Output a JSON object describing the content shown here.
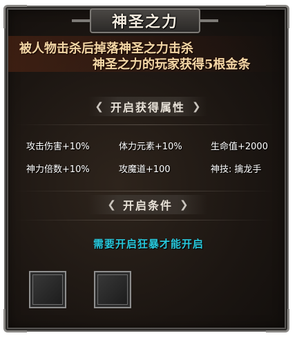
{
  "title": "神圣之力",
  "banner": {
    "line1": "被人物击杀后掉落神圣之力击杀",
    "line2": "神圣之力的玩家获得5根金条"
  },
  "attributes_section": {
    "left_arrow": "❮",
    "label": "开启获得属性",
    "right_arrow": "❯",
    "items": [
      {
        "text": "攻击伤害+10%"
      },
      {
        "text": "体力元素+10%"
      },
      {
        "text": "生命值+2000"
      },
      {
        "text": "神力倍数+10%"
      },
      {
        "text": "攻魔道+100"
      },
      {
        "text": "神技: 擒龙手"
      }
    ]
  },
  "conditions_section": {
    "left_arrow": "❮",
    "label": "开启条件",
    "right_arrow": "❯",
    "condition_text": "需要开启狂暴才能开启"
  },
  "item_slots": [
    {
      "icon": "empty-slot"
    },
    {
      "icon": "empty-slot"
    }
  ]
}
